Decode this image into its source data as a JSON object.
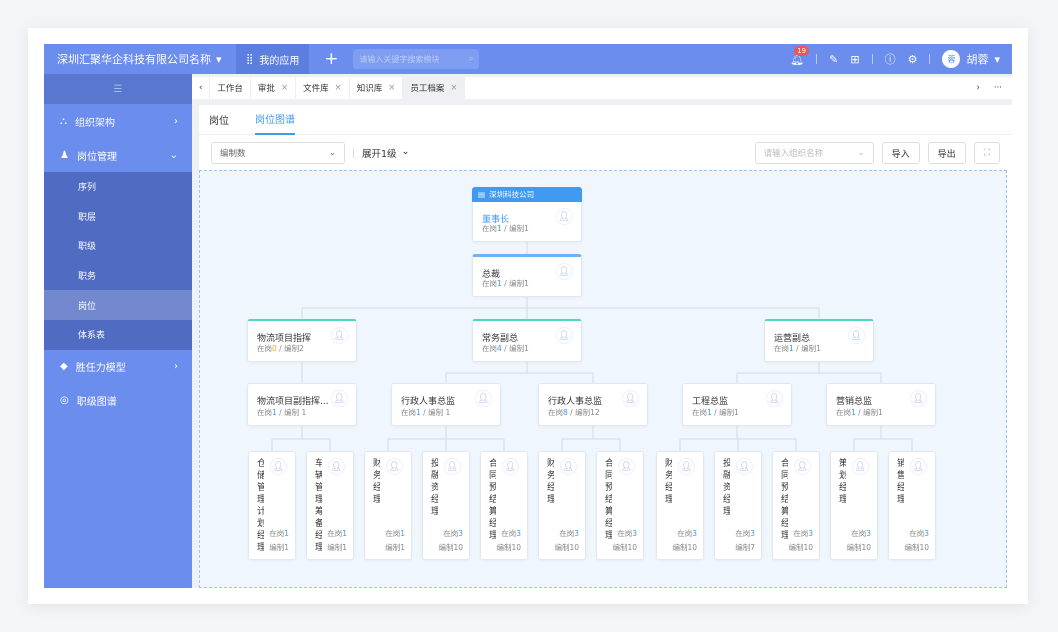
{
  "header": {
    "company": "深圳汇聚华企科技有限公司名称",
    "my_apps": "我的应用",
    "search_placeholder": "请输入关键字搜索模块",
    "notification_count": "19",
    "user_name": "胡蓉",
    "avatar_text": "蓉"
  },
  "sidebar": {
    "items": [
      {
        "label": "组织架构",
        "icon": "org-icon"
      },
      {
        "label": "岗位管理",
        "icon": "position-icon",
        "sub": [
          "序列",
          "职层",
          "职级",
          "职务",
          "岗位",
          "体系表"
        ],
        "active_sub": "岗位"
      },
      {
        "label": "胜任力模型",
        "icon": "cube-icon"
      },
      {
        "label": "职级图谱",
        "icon": "target-icon"
      }
    ]
  },
  "tabs": [
    {
      "label": "工作台"
    },
    {
      "label": "审批"
    },
    {
      "label": "文件库"
    },
    {
      "label": "知识库"
    },
    {
      "label": "员工档案",
      "active": true
    }
  ],
  "page_tabs": [
    {
      "label": "岗位"
    },
    {
      "label": "岗位图谱",
      "active": true
    }
  ],
  "toolbar": {
    "metric_select": "编制数",
    "expand_select": "展开1级",
    "org_placeholder": "请输入组织名称",
    "import": "导入",
    "export": "导出"
  },
  "labels": {
    "on_post": "在岗",
    "quota": "编制",
    "sep": " / "
  },
  "colors": {
    "accent": "#3f9af0",
    "header": "#6b8ded",
    "teal": "#4fd6c4",
    "warning": "#f5a623"
  },
  "org_chart": {
    "company": "深圳科技公司",
    "nodes": [
      {
        "title": "董事长",
        "on": "1",
        "quota": "1",
        "parent": null
      },
      {
        "title": "总裁",
        "on": "1",
        "quota": "1",
        "parent": 0
      },
      {
        "title": "物流项目指挥",
        "on": "0",
        "quota": "2",
        "parent": 1
      },
      {
        "title": "常务副总",
        "on": "4",
        "quota": "1",
        "parent": 1
      },
      {
        "title": "运营副总",
        "on": "1",
        "quota": "1",
        "parent": 1
      },
      {
        "title": "物流项目副指挥...",
        "on": "1",
        "quota": " 1",
        "parent": 2
      },
      {
        "title": "行政人事总监",
        "on": "1",
        "quota": " 1",
        "parent": 3
      },
      {
        "title": "行政人事总监",
        "on": "8",
        "quota": "12",
        "parent": 3
      },
      {
        "title": "工程总监",
        "on": "1",
        "quota": "1",
        "parent": 4
      },
      {
        "title": "营销总监",
        "on": "1",
        "quota": "1",
        "parent": 4
      },
      {
        "title": "仓储管理计划经理",
        "on": "1",
        "quota": "1",
        "parent": 5
      },
      {
        "title": "车辆管理筹备经理",
        "on": "1",
        "quota": "1",
        "parent": 5
      },
      {
        "title": "财务经理",
        "on": "1",
        "quota": "1",
        "parent": 6
      },
      {
        "title": "投融资经理",
        "on": "3",
        "quota": "10",
        "parent": 6
      },
      {
        "title": "合同预结算经理",
        "on": "3",
        "quota": "10",
        "parent": 6
      },
      {
        "title": "财务经理",
        "on": "3",
        "quota": "10",
        "parent": 7
      },
      {
        "title": "合同预结算经理",
        "on": "3",
        "quota": "10",
        "parent": 7
      },
      {
        "title": "财务经理",
        "on": "3",
        "quota": "10",
        "parent": 8
      },
      {
        "title": "投融资经理",
        "on": "3",
        "quota": "7",
        "parent": 8
      },
      {
        "title": "合同预结算经理",
        "on": "3",
        "quota": "10",
        "parent": 8
      },
      {
        "title": "策划经理",
        "on": "3",
        "quota": "10",
        "parent": 9
      },
      {
        "title": "销售经理",
        "on": "3",
        "quota": "10",
        "parent": 9
      }
    ]
  }
}
